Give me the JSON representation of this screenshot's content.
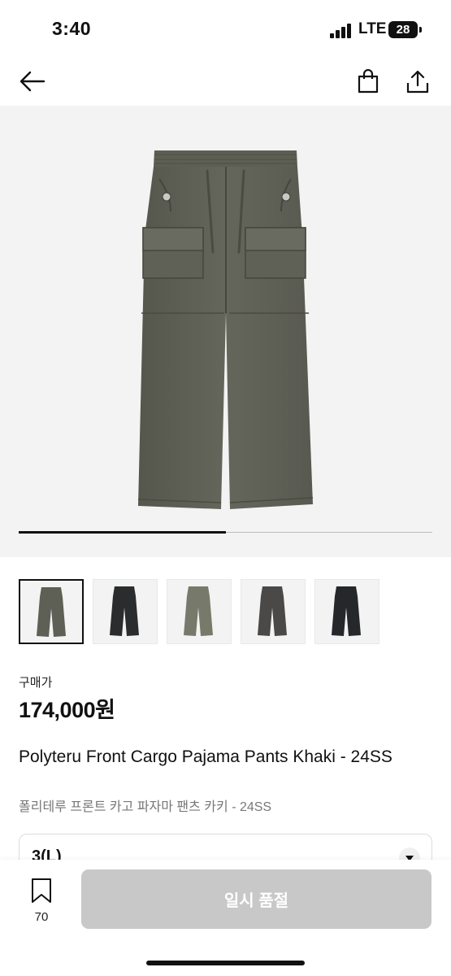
{
  "status": {
    "time": "3:40",
    "network": "LTE",
    "battery": "28"
  },
  "nav": {
    "back_icon": "arrow-left-icon",
    "bag_icon": "shopping-bag-icon",
    "share_icon": "share-icon"
  },
  "hero": {
    "image": "khaki-cargo-pants",
    "carousel_progress": 0.5
  },
  "thumbnails": [
    {
      "color_name": "khaki",
      "color": "#5e5f55",
      "selected": true
    },
    {
      "color_name": "black",
      "color": "#2a2c2e",
      "selected": false
    },
    {
      "color_name": "olive",
      "color": "#777a6a",
      "selected": false
    },
    {
      "color_name": "charcoal",
      "color": "#4a4948",
      "selected": false
    },
    {
      "color_name": "black",
      "color": "#25272a",
      "selected": false
    }
  ],
  "product": {
    "price_label": "구매가",
    "price": "174,000원",
    "title_en": "Polyteru Front Cargo Pajama Pants Khaki - 24SS",
    "title_ko": "폴리테루 프론트 카고 파자마 팬츠 카키 - 24SS"
  },
  "size_select": {
    "value": "3(L)"
  },
  "bottom": {
    "bookmark_count": "70",
    "soldout_label": "일시 품절"
  },
  "colors": {
    "hero_bg": "#f3f3f3",
    "button_disabled": "#c8c8c8",
    "pants_khaki": "#5e5f55"
  }
}
